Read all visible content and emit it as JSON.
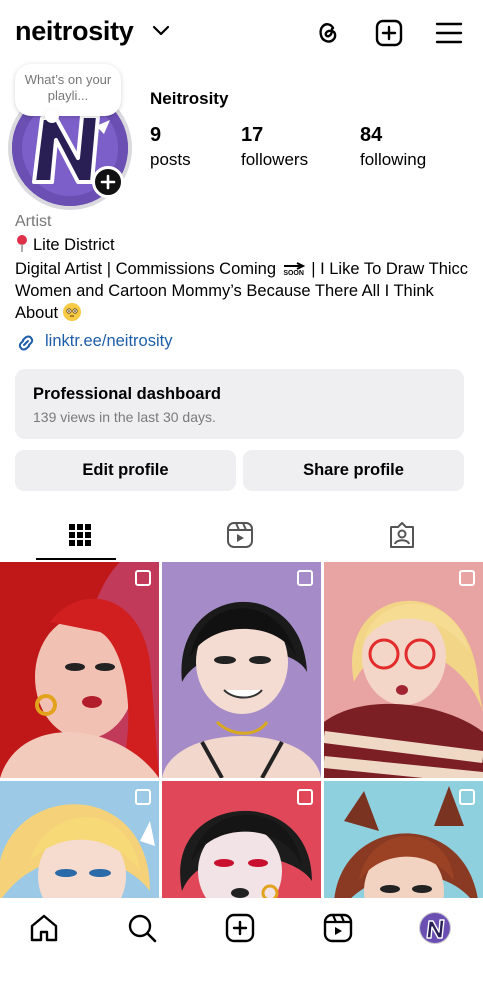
{
  "header": {
    "username": "neitrosity",
    "icons": [
      "chevron-down-icon",
      "threads-icon",
      "add-post-icon",
      "menu-icon"
    ]
  },
  "profile": {
    "note": "What’s on your playli...",
    "display_name": "Neitrosity",
    "stats": [
      {
        "value": "9",
        "label": "posts"
      },
      {
        "value": "17",
        "label": "followers"
      },
      {
        "value": "84",
        "label": "following"
      }
    ],
    "category": "Artist",
    "location": "Lite District",
    "bio_part1": "Digital Artist | Commissions Coming",
    "bio_soon": "SOON",
    "bio_part2": "| I Like To Draw Thicc Women and Cartoon Mommy’s Because There All I Think About",
    "link": "linktr.ee/neitrosity"
  },
  "dashboard": {
    "title": "Professional dashboard",
    "subtitle": "139 views in the last 30 days."
  },
  "buttons": {
    "edit": "Edit profile",
    "share": "Share profile"
  },
  "tabs": [
    "grid-icon",
    "reels-icon",
    "tagged-icon"
  ],
  "grid_posts": [
    {
      "bg": "#c23a5a",
      "hair": "#c01818"
    },
    {
      "bg": "#a58cc8",
      "hair": "#1a1a1a"
    },
    {
      "bg": "#e8a3a3",
      "hair": "#f2d587"
    },
    {
      "bg": "#9cc9e6",
      "hair": "#f5d27a"
    },
    {
      "bg": "#e0485a",
      "hair": "#1c1c1c"
    },
    {
      "bg": "#8fd0df",
      "hair": "#8a3a22"
    }
  ],
  "bottom_nav": [
    "home-icon",
    "search-icon",
    "create-icon",
    "reels-icon",
    "profile-avatar"
  ]
}
